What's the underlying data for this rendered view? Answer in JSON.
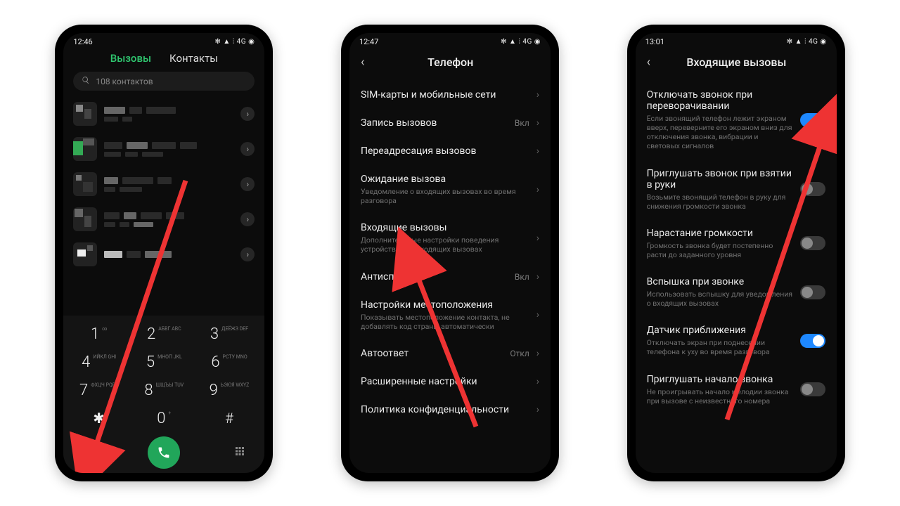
{
  "phone1": {
    "time": "12:46",
    "status_icons": "✻ ▲ ⫶ 4G  ◉",
    "tabs": {
      "calls": "Вызовы",
      "contacts": "Контакты"
    },
    "search_placeholder": "108 контактов",
    "dialer": {
      "k1": "1",
      "k1s": "∞",
      "k2": "2",
      "k2s": "АБВГ\nABC",
      "k3": "3",
      "k3s": "ДЕЁЖЗ\nDEF",
      "k4": "4",
      "k4s": "ИЙКЛ\nGHI",
      "k5": "5",
      "k5s": "МНОП\nJKL",
      "k6": "6",
      "k6s": "РСТУ\nMNO",
      "k7": "7",
      "k7s": "ФХЦЧ\nPQRS",
      "k8": "8",
      "k8s": "ШЩЪЫ\nTUV",
      "k9": "9",
      "k9s": "ЬЭЮЯ\nWXYZ",
      "kstar": "✱",
      "k0": "0",
      "k0s": "+",
      "khash": "#"
    }
  },
  "phone2": {
    "time": "12:47",
    "status_icons": "✻ ▲ ⫶ 4G  ◉",
    "header": "Телефон",
    "rows": [
      {
        "title": "SIM-карты и мобильные сети"
      },
      {
        "title": "Запись вызовов",
        "value": "Вкл"
      },
      {
        "title": "Переадресация вызовов"
      },
      {
        "title": "Ожидание вызова",
        "sub": "Уведомление о входящих вызовах во время разговора"
      },
      {
        "title": "Входящие вызовы",
        "sub": "Дополнительные настройки поведения устройства при входящих вызовах"
      },
      {
        "title": "Антиспам",
        "value": "Вкл"
      },
      {
        "title": "Настройки местоположения",
        "sub": "Показывать местоположение контакта, не добавлять код страны автоматически"
      },
      {
        "title": "Автоответ",
        "value": "Откл"
      },
      {
        "title": "Расширенные настройки"
      },
      {
        "title": "Политика конфиденциальности"
      }
    ]
  },
  "phone3": {
    "time": "13:01",
    "status_icons": "✻ ▲ ⫶ 4G  ◉",
    "header": "Входящие вызовы",
    "rows": [
      {
        "title": "Отключать звонок при переворачивании",
        "sub": "Если звонящий телефон лежит экраном вверх, переверните его экраном вниз для отключения звонка, вибрации и световых сигналов",
        "toggle": "on"
      },
      {
        "title": "Приглушать звонок при взятии в руки",
        "sub": "Возьмите звонящий телефон в руку для снижения громкости звонка",
        "toggle": "off"
      },
      {
        "title": "Нарастание громкости",
        "sub": "Громкость звонка будет постепенно расти до заданного уровня",
        "toggle": "off"
      },
      {
        "title": "Вспышка при звонке",
        "sub": "Использовать вспышку для уведомления о входящих вызовах",
        "toggle": "off"
      },
      {
        "title": "Датчик приближения",
        "sub": "Отключать экран при поднесении телефона к уху во время разговора",
        "toggle": "on"
      },
      {
        "title": "Приглушать начало звонка",
        "sub": "Не проигрывать начало мелодии звонка при вызове с неизвестного номера",
        "toggle": "off"
      }
    ]
  }
}
